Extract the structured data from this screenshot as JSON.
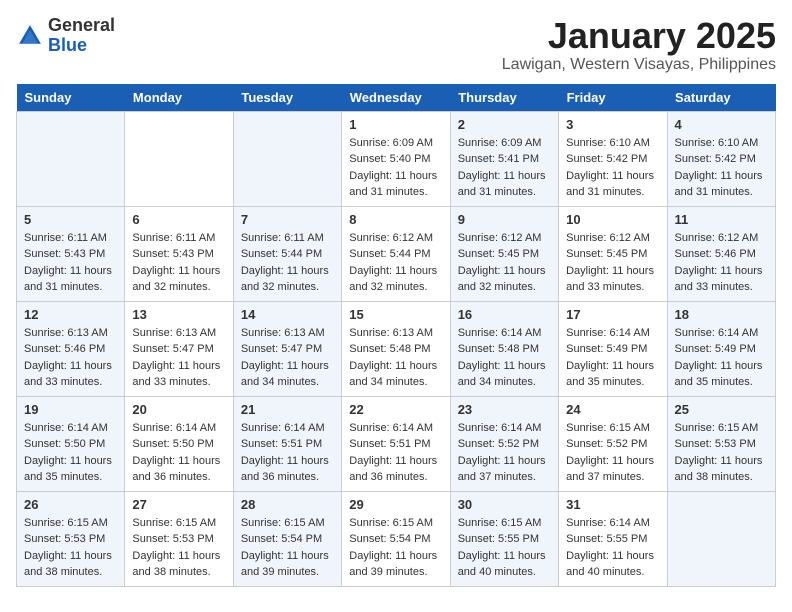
{
  "header": {
    "logo_general": "General",
    "logo_blue": "Blue",
    "month": "January 2025",
    "location": "Lawigan, Western Visayas, Philippines"
  },
  "days_of_week": [
    "Sunday",
    "Monday",
    "Tuesday",
    "Wednesday",
    "Thursday",
    "Friday",
    "Saturday"
  ],
  "weeks": [
    [
      {
        "day": "",
        "info": ""
      },
      {
        "day": "",
        "info": ""
      },
      {
        "day": "",
        "info": ""
      },
      {
        "day": "1",
        "info": "Sunrise: 6:09 AM\nSunset: 5:40 PM\nDaylight: 11 hours and 31 minutes."
      },
      {
        "day": "2",
        "info": "Sunrise: 6:09 AM\nSunset: 5:41 PM\nDaylight: 11 hours and 31 minutes."
      },
      {
        "day": "3",
        "info": "Sunrise: 6:10 AM\nSunset: 5:42 PM\nDaylight: 11 hours and 31 minutes."
      },
      {
        "day": "4",
        "info": "Sunrise: 6:10 AM\nSunset: 5:42 PM\nDaylight: 11 hours and 31 minutes."
      }
    ],
    [
      {
        "day": "5",
        "info": "Sunrise: 6:11 AM\nSunset: 5:43 PM\nDaylight: 11 hours and 31 minutes."
      },
      {
        "day": "6",
        "info": "Sunrise: 6:11 AM\nSunset: 5:43 PM\nDaylight: 11 hours and 32 minutes."
      },
      {
        "day": "7",
        "info": "Sunrise: 6:11 AM\nSunset: 5:44 PM\nDaylight: 11 hours and 32 minutes."
      },
      {
        "day": "8",
        "info": "Sunrise: 6:12 AM\nSunset: 5:44 PM\nDaylight: 11 hours and 32 minutes."
      },
      {
        "day": "9",
        "info": "Sunrise: 6:12 AM\nSunset: 5:45 PM\nDaylight: 11 hours and 32 minutes."
      },
      {
        "day": "10",
        "info": "Sunrise: 6:12 AM\nSunset: 5:45 PM\nDaylight: 11 hours and 33 minutes."
      },
      {
        "day": "11",
        "info": "Sunrise: 6:12 AM\nSunset: 5:46 PM\nDaylight: 11 hours and 33 minutes."
      }
    ],
    [
      {
        "day": "12",
        "info": "Sunrise: 6:13 AM\nSunset: 5:46 PM\nDaylight: 11 hours and 33 minutes."
      },
      {
        "day": "13",
        "info": "Sunrise: 6:13 AM\nSunset: 5:47 PM\nDaylight: 11 hours and 33 minutes."
      },
      {
        "day": "14",
        "info": "Sunrise: 6:13 AM\nSunset: 5:47 PM\nDaylight: 11 hours and 34 minutes."
      },
      {
        "day": "15",
        "info": "Sunrise: 6:13 AM\nSunset: 5:48 PM\nDaylight: 11 hours and 34 minutes."
      },
      {
        "day": "16",
        "info": "Sunrise: 6:14 AM\nSunset: 5:48 PM\nDaylight: 11 hours and 34 minutes."
      },
      {
        "day": "17",
        "info": "Sunrise: 6:14 AM\nSunset: 5:49 PM\nDaylight: 11 hours and 35 minutes."
      },
      {
        "day": "18",
        "info": "Sunrise: 6:14 AM\nSunset: 5:49 PM\nDaylight: 11 hours and 35 minutes."
      }
    ],
    [
      {
        "day": "19",
        "info": "Sunrise: 6:14 AM\nSunset: 5:50 PM\nDaylight: 11 hours and 35 minutes."
      },
      {
        "day": "20",
        "info": "Sunrise: 6:14 AM\nSunset: 5:50 PM\nDaylight: 11 hours and 36 minutes."
      },
      {
        "day": "21",
        "info": "Sunrise: 6:14 AM\nSunset: 5:51 PM\nDaylight: 11 hours and 36 minutes."
      },
      {
        "day": "22",
        "info": "Sunrise: 6:14 AM\nSunset: 5:51 PM\nDaylight: 11 hours and 36 minutes."
      },
      {
        "day": "23",
        "info": "Sunrise: 6:14 AM\nSunset: 5:52 PM\nDaylight: 11 hours and 37 minutes."
      },
      {
        "day": "24",
        "info": "Sunrise: 6:15 AM\nSunset: 5:52 PM\nDaylight: 11 hours and 37 minutes."
      },
      {
        "day": "25",
        "info": "Sunrise: 6:15 AM\nSunset: 5:53 PM\nDaylight: 11 hours and 38 minutes."
      }
    ],
    [
      {
        "day": "26",
        "info": "Sunrise: 6:15 AM\nSunset: 5:53 PM\nDaylight: 11 hours and 38 minutes."
      },
      {
        "day": "27",
        "info": "Sunrise: 6:15 AM\nSunset: 5:53 PM\nDaylight: 11 hours and 38 minutes."
      },
      {
        "day": "28",
        "info": "Sunrise: 6:15 AM\nSunset: 5:54 PM\nDaylight: 11 hours and 39 minutes."
      },
      {
        "day": "29",
        "info": "Sunrise: 6:15 AM\nSunset: 5:54 PM\nDaylight: 11 hours and 39 minutes."
      },
      {
        "day": "30",
        "info": "Sunrise: 6:15 AM\nSunset: 5:55 PM\nDaylight: 11 hours and 40 minutes."
      },
      {
        "day": "31",
        "info": "Sunrise: 6:14 AM\nSunset: 5:55 PM\nDaylight: 11 hours and 40 minutes."
      },
      {
        "day": "",
        "info": ""
      }
    ]
  ]
}
